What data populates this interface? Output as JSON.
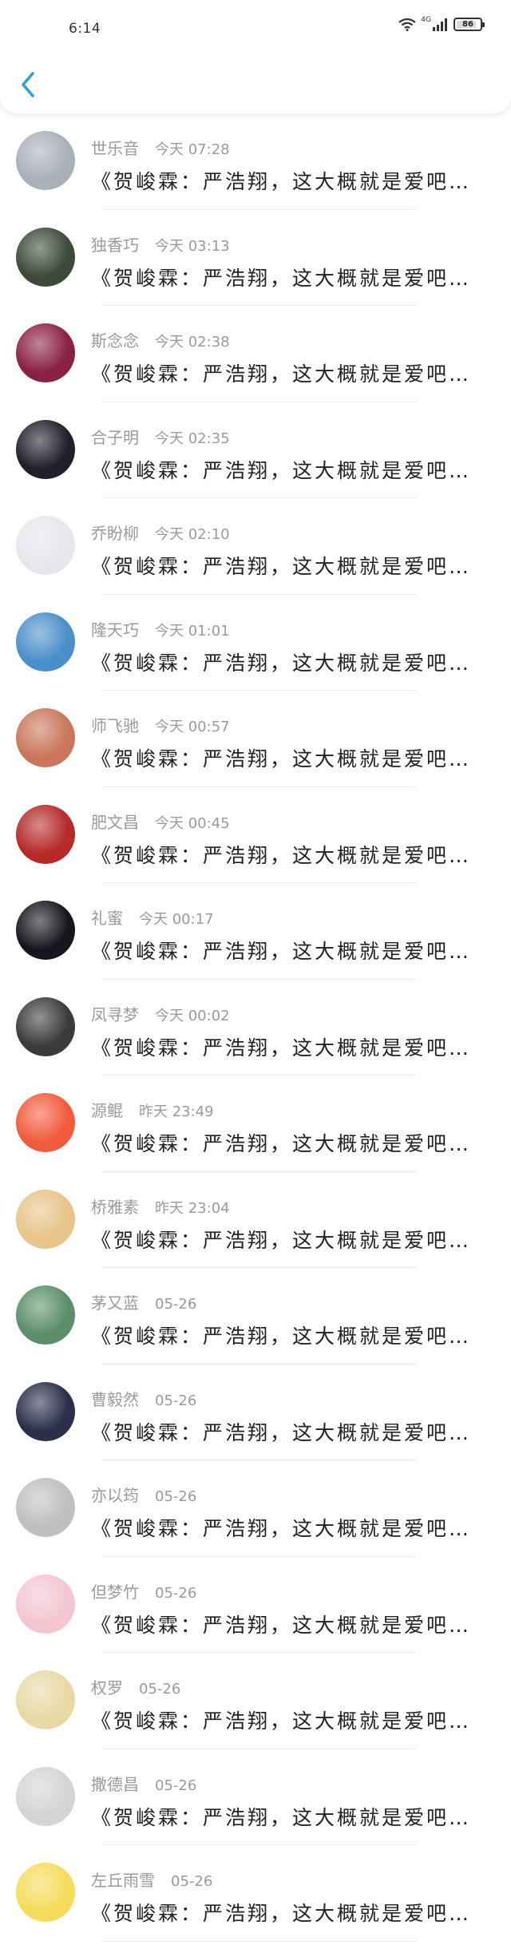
{
  "status_bar": {
    "time": "6:14",
    "network": "4G",
    "battery": "86",
    "battery_level": 0.86
  },
  "header": {
    "back_icon": "chevron-left-icon",
    "accent_color": "#2f9ee8"
  },
  "message_preview": "《贺峻霖：严浩翔，这大概就是爱吧（转）》",
  "conversations": [
    {
      "name": "世乐音",
      "time": "今天 07:28",
      "avatar": "#aab0b8"
    },
    {
      "name": "独香巧",
      "time": "今天 03:13",
      "avatar": "#3d4a3a"
    },
    {
      "name": "斯念念",
      "time": "今天 02:38",
      "avatar": "#8a2145"
    },
    {
      "name": "合子明",
      "time": "今天 02:35",
      "avatar": "#20202a"
    },
    {
      "name": "乔盼柳",
      "time": "今天 02:10",
      "avatar": "#e6e6ec"
    },
    {
      "name": "隆天巧",
      "time": "今天 01:01",
      "avatar": "#4a8fc9"
    },
    {
      "name": "师飞驰",
      "time": "今天 00:57",
      "avatar": "#c9765a"
    },
    {
      "name": "肥文昌",
      "time": "今天 00:45",
      "avatar": "#b62a2a"
    },
    {
      "name": "礼蜜",
      "time": "今天 00:17",
      "avatar": "#16161e"
    },
    {
      "name": "凤寻梦",
      "time": "今天 00:02",
      "avatar": "#3b3b3b"
    },
    {
      "name": "源鲲",
      "time": "昨天 23:49",
      "avatar": "#f25b3c"
    },
    {
      "name": "桥雅素",
      "time": "昨天 23:04",
      "avatar": "#e7c489"
    },
    {
      "name": "茅又蓝",
      "time": "05-26",
      "avatar": "#5a8f6a"
    },
    {
      "name": "曹毅然",
      "time": "05-26",
      "avatar": "#2b2f4a"
    },
    {
      "name": "亦以筠",
      "time": "05-26",
      "avatar": "#bfbfbf"
    },
    {
      "name": "但梦竹",
      "time": "05-26",
      "avatar": "#f3c6d1"
    },
    {
      "name": "权罗",
      "time": "05-26",
      "avatar": "#e8d9a4"
    },
    {
      "name": "撒德昌",
      "time": "05-26",
      "avatar": "#d4d4d4"
    },
    {
      "name": "左丘雨雪",
      "time": "05-26",
      "avatar": "#f5dc5a"
    }
  ]
}
